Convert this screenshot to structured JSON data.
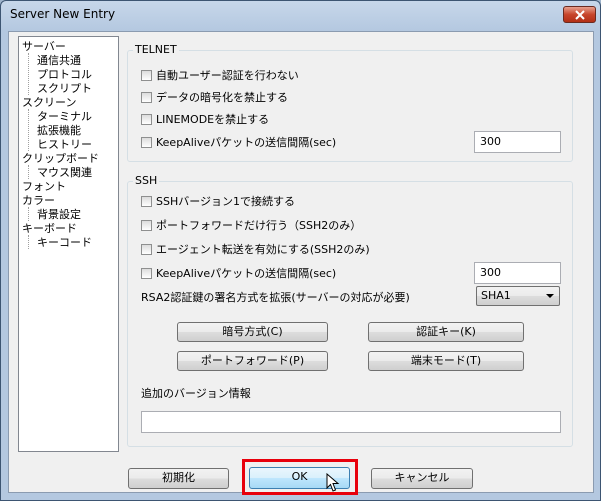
{
  "window": {
    "title": "Server New Entry",
    "close_icon": "close-icon"
  },
  "tree": {
    "items": [
      {
        "label": "サーバー",
        "level": 0
      },
      {
        "label": "通信共通",
        "level": 1
      },
      {
        "label": "プロトコル",
        "level": 1
      },
      {
        "label": "スクリプト",
        "level": 1
      },
      {
        "label": "スクリーン",
        "level": 0
      },
      {
        "label": "ターミナル",
        "level": 1
      },
      {
        "label": "拡張機能",
        "level": 1
      },
      {
        "label": "ヒストリー",
        "level": 1
      },
      {
        "label": "クリップボード",
        "level": 0
      },
      {
        "label": "マウス関連",
        "level": 1
      },
      {
        "label": "フォント",
        "level": 0
      },
      {
        "label": "カラー",
        "level": 0
      },
      {
        "label": "背景設定",
        "level": 1
      },
      {
        "label": "キーボード",
        "level": 0
      },
      {
        "label": "キーコード",
        "level": 1
      }
    ]
  },
  "telnet": {
    "group_label": "TELNET",
    "auto_login": "自動ユーザー認証を行わない",
    "disable_encryption": "データの暗号化を禁止する",
    "disable_linemode": "LINEMODEを禁止する",
    "keepalive": "KeepAliveパケットの送信間隔(sec)",
    "keepalive_value": "300"
  },
  "ssh": {
    "group_label": "SSH",
    "ssh1": "SSHバージョン1で接続する",
    "port_forward_only": "ポートフォワードだけ行う（SSH2のみ）",
    "agent_forward": "エージェント転送を有効にする(SSH2のみ)",
    "keepalive": "KeepAliveパケットの送信間隔(sec)",
    "keepalive_value": "300",
    "rsa2_label": "RSA2認証鍵の署名方式を拡張(サーバーの対応が必要)",
    "rsa2_value": "SHA1",
    "cipher_button": "暗号方式(C)",
    "auth_key_button": "認証キー(K)",
    "port_forward_button": "ポートフォワード(P)",
    "terminal_mode_button": "端末モード(T)",
    "extra_version_label": "追加のバージョン情報",
    "extra_version_value": ""
  },
  "footer": {
    "reset_button": "初期化",
    "ok_button": "OK",
    "cancel_button": "キャンセル"
  },
  "colors": {
    "highlight": "#e8000c"
  }
}
